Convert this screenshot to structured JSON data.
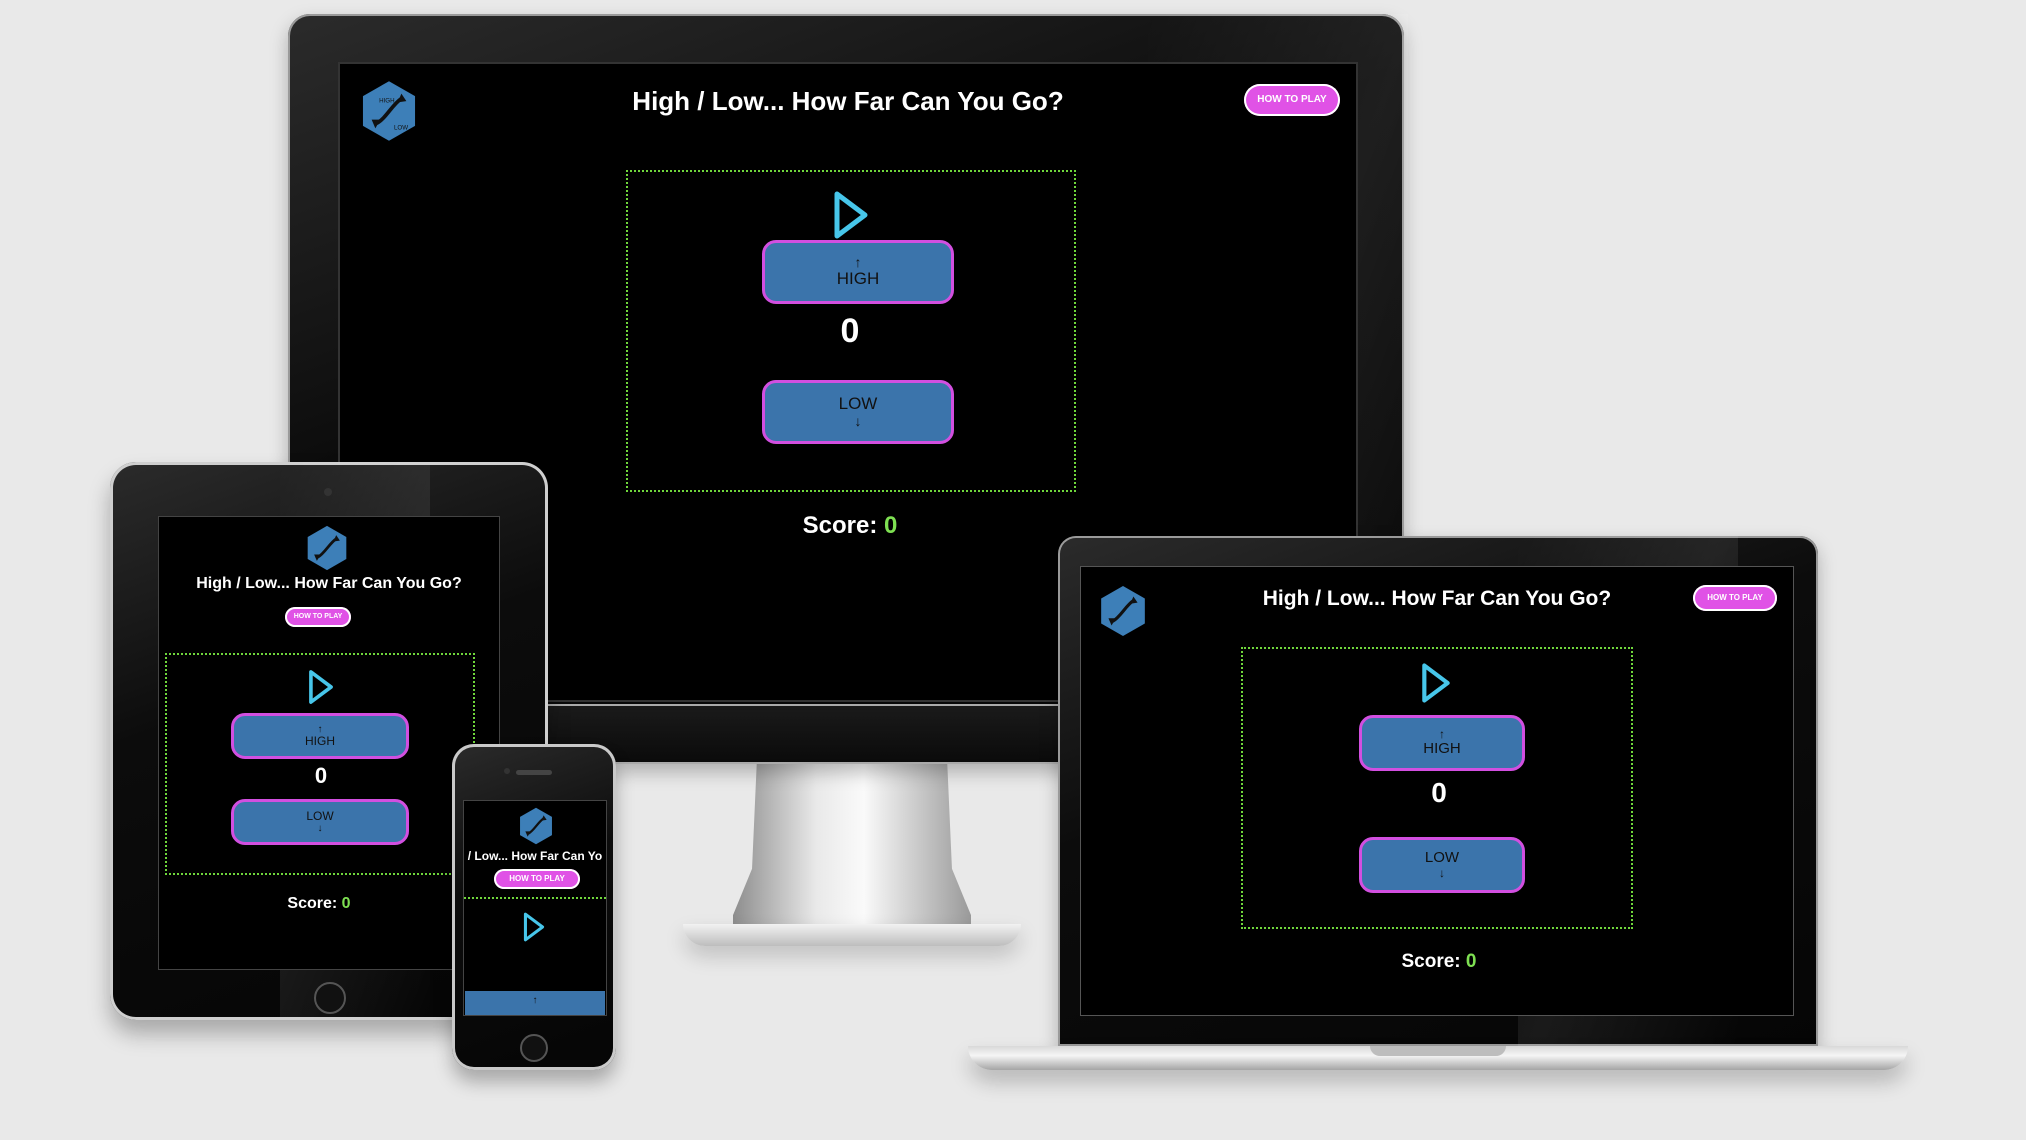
{
  "app": {
    "title": "High / Low... How Far Can You Go?",
    "title_clipped": "/ Low... How Far Can Yo",
    "how_to_play": "HOW TO PLAY",
    "logo_text_top": "HIGH",
    "logo_text_bottom": "LOW",
    "high_label": "HIGH",
    "low_label": "LOW",
    "up_arrow": "↑",
    "down_arrow": "↓",
    "counter_value": "0",
    "score_label": "Score:",
    "score_value": "0"
  },
  "colors": {
    "accent_pink": "#e052e6",
    "button_blue": "#3b74ab",
    "button_border": "#d24fe0",
    "game_border": "#6fd63b",
    "score_green": "#7ee052",
    "play_icon": "#47c6ea"
  },
  "icons": {
    "logo": "hexagon-arrows-logo",
    "play": "play-triangle-icon"
  }
}
